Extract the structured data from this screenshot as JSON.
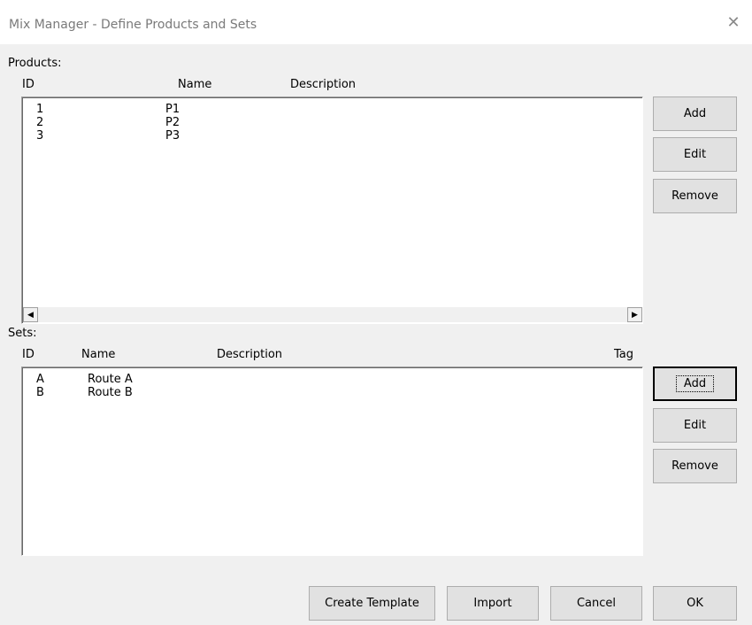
{
  "window": {
    "title": "Mix Manager - Define Products and Sets",
    "close_glyph": "✕"
  },
  "products": {
    "label": "Products:",
    "columns": {
      "id": "ID",
      "name": "Name",
      "description": "Description"
    },
    "rows": [
      {
        "id": "1",
        "name": "P1",
        "description": ""
      },
      {
        "id": "2",
        "name": "P2",
        "description": ""
      },
      {
        "id": "3",
        "name": "P3",
        "description": ""
      }
    ],
    "buttons": {
      "add": "Add",
      "edit": "Edit",
      "remove": "Remove"
    },
    "scroll_left_glyph": "◀",
    "scroll_right_glyph": "▶"
  },
  "sets": {
    "label": "Sets:",
    "columns": {
      "id": "ID",
      "name": "Name",
      "description": "Description",
      "tag": "Tag"
    },
    "rows": [
      {
        "id": "A",
        "name": "Route A",
        "description": "",
        "tag": ""
      },
      {
        "id": "B",
        "name": "Route B",
        "description": "",
        "tag": ""
      }
    ],
    "buttons": {
      "add": "Add",
      "edit": "Edit",
      "remove": "Remove"
    }
  },
  "footer": {
    "create_template": "Create Template",
    "import": "Import",
    "cancel": "Cancel",
    "ok": "OK"
  }
}
